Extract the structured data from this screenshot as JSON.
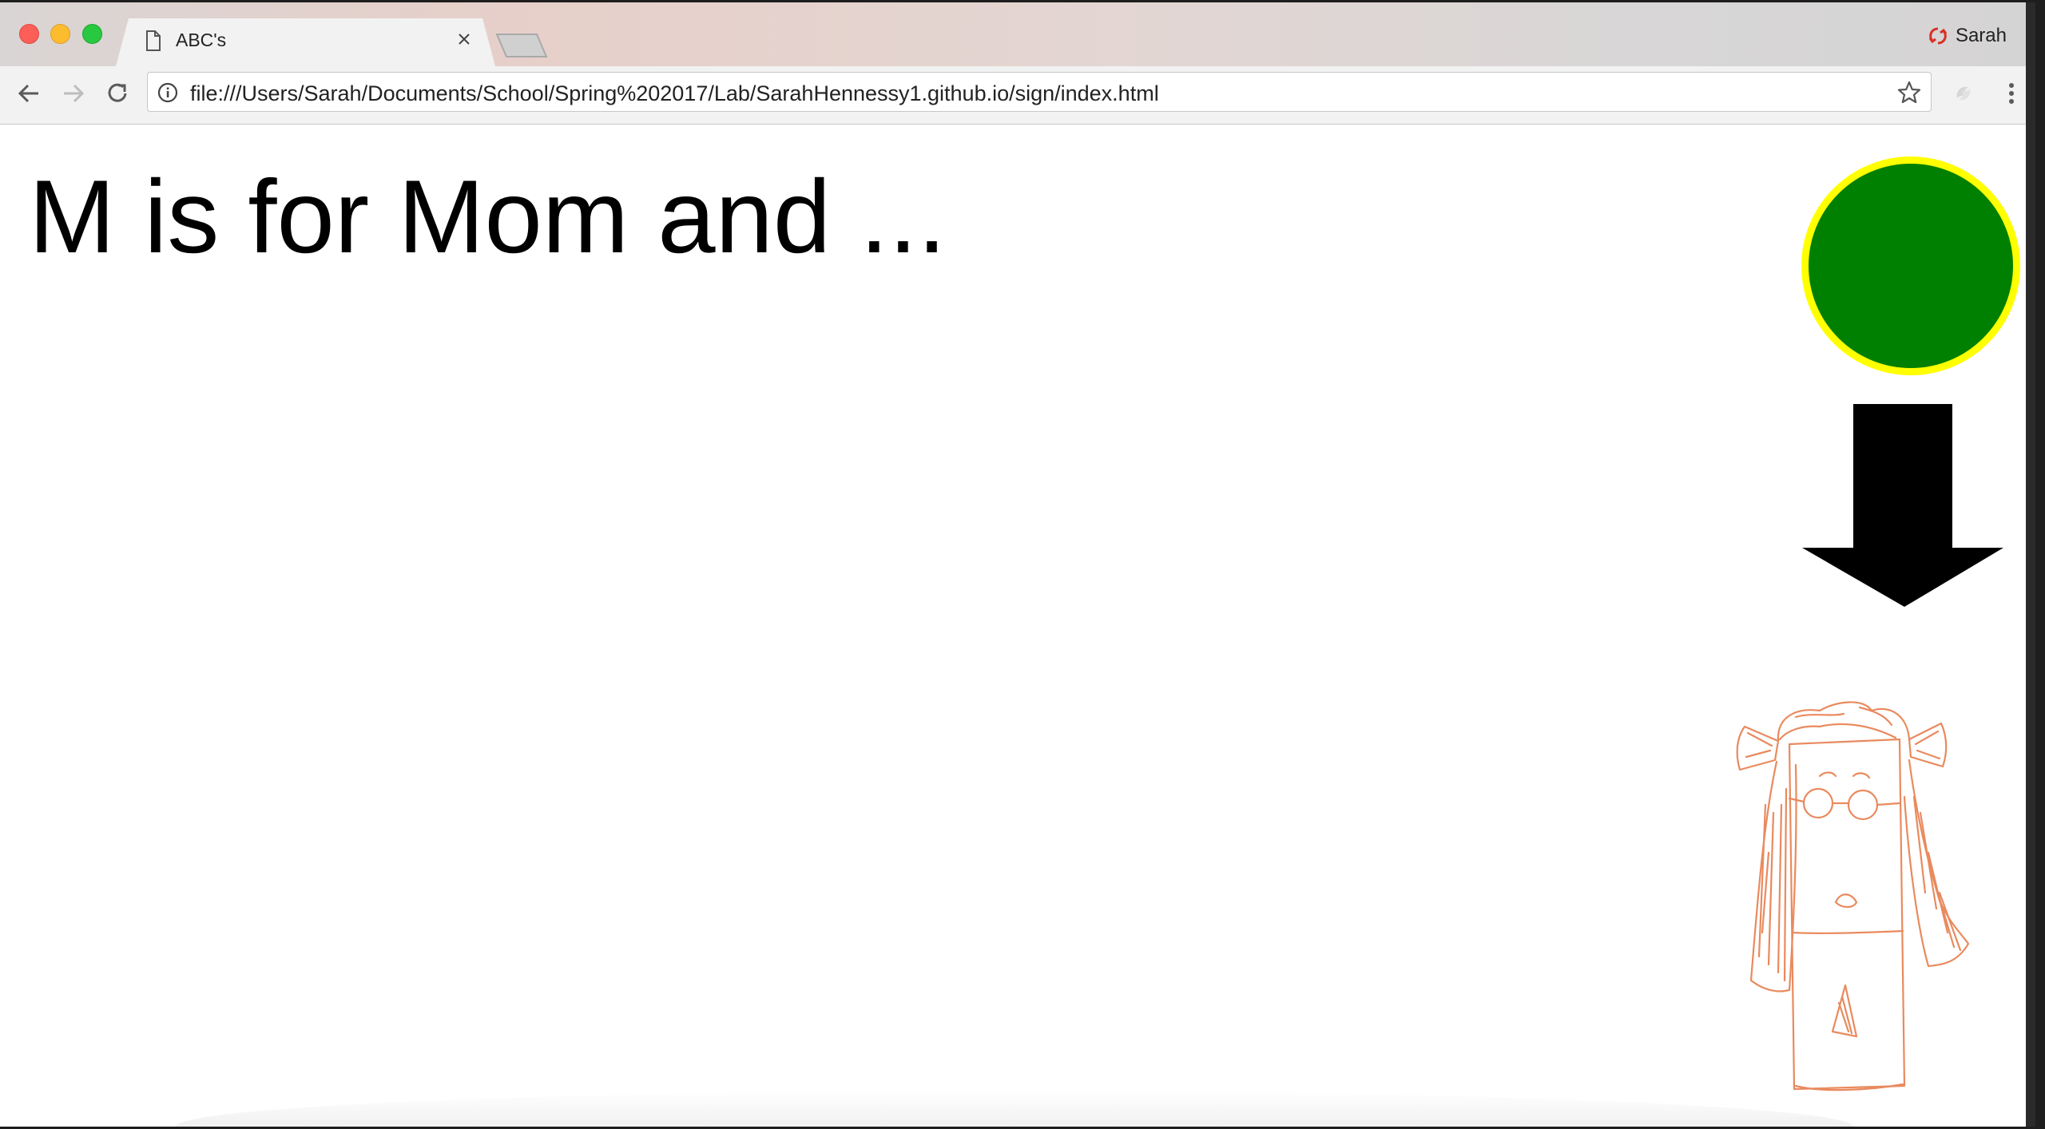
{
  "browser": {
    "tab": {
      "title": "ABC's"
    },
    "profile": {
      "name": "Sarah"
    },
    "address_bar": {
      "url": "file:///Users/Sarah/Documents/School/Spring%202017/Lab/SarahHennessy1.github.io/sign/index.html"
    }
  },
  "page": {
    "heading": "M is for Mom and ...",
    "circle": {
      "fill": "#008000",
      "border": "#ffff00"
    },
    "arrow": {
      "color": "#000000",
      "direction": "down"
    },
    "drawing": {
      "subject": "crayon-drawing-of-mom",
      "stroke": "#e98a5e"
    }
  }
}
